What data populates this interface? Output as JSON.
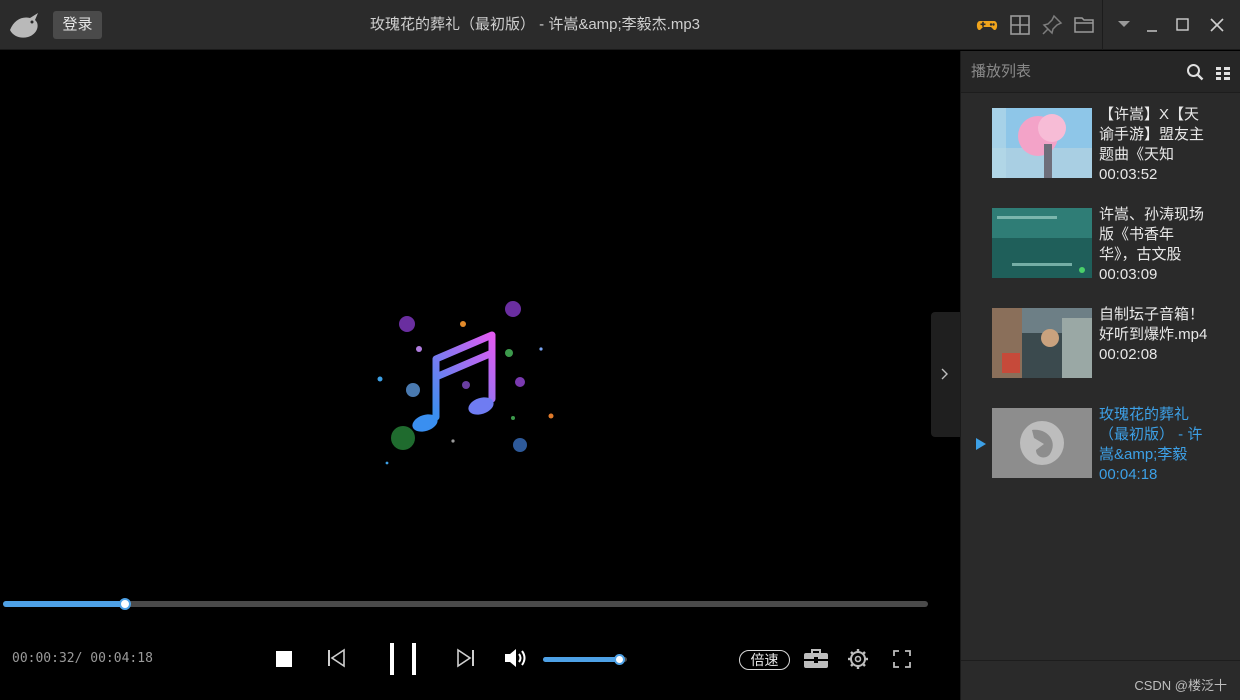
{
  "titlebar": {
    "login_label": "登录",
    "title": "玫瑰花的葬礼（最初版） - 许嵩&amp;李毅杰.mp3",
    "icons": [
      "gamepad-icon",
      "grid-icon",
      "pin-icon",
      "folder-icon",
      "dropdown-icon",
      "minimize-icon",
      "maximize-icon",
      "close-icon"
    ]
  },
  "player": {
    "current_time": "00:00:32",
    "separator": "/ ",
    "total_time": "00:04:18",
    "progress_fraction": 0.132,
    "volume_fraction": 0.92,
    "speed_label": "倍速"
  },
  "playlist": {
    "title": "播放列表",
    "items": [
      {
        "title": "【许嵩】X【天谕手游】盟友主题曲《天知",
        "duration": "00:03:52",
        "active": false
      },
      {
        "title": "许嵩、孙涛现场版《书香年华》，古文股",
        "duration": "00:03:09",
        "active": false
      },
      {
        "title": "自制坛子音箱！好听到爆炸.mp4",
        "duration": "00:02:08",
        "active": false
      },
      {
        "title": "玫瑰花的葬礼（最初版） - 许嵩&amp;李毅",
        "duration": "00:04:18",
        "active": true
      }
    ]
  },
  "watermark": "CSDN @楼泛十",
  "colors": {
    "accent": "#4ea1e6",
    "active_text": "#3da0e6",
    "titlebar_bg": "#2b2b2b",
    "panel_bg": "#2a2a2a",
    "gamepad": "#f0a41c"
  }
}
